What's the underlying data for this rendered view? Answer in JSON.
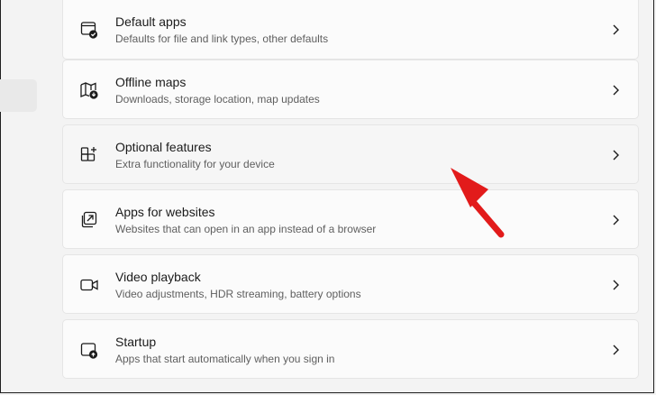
{
  "settings_list": {
    "items": [
      {
        "title": "Default apps",
        "subtitle": "Defaults for file and link types, other defaults",
        "icon": "default-apps-icon"
      },
      {
        "title": "Offline maps",
        "subtitle": "Downloads, storage location, map updates",
        "icon": "offline-maps-icon"
      },
      {
        "title": "Optional features",
        "subtitle": "Extra functionality for your device",
        "icon": "optional-features-icon"
      },
      {
        "title": "Apps for websites",
        "subtitle": "Websites that can open in an app instead of a browser",
        "icon": "apps-for-websites-icon"
      },
      {
        "title": "Video playback",
        "subtitle": "Video adjustments, HDR streaming, battery options",
        "icon": "video-playback-icon"
      },
      {
        "title": "Startup",
        "subtitle": "Apps that start automatically when you sign in",
        "icon": "startup-icon"
      }
    ]
  },
  "colors": {
    "background": "#f3f3f3",
    "card": "#fbfbfb",
    "card_border": "#e5e5e5",
    "title_text": "#1b1b1b",
    "subtitle_text": "#5f5f5f",
    "annotation_arrow": "#e21b1b"
  }
}
